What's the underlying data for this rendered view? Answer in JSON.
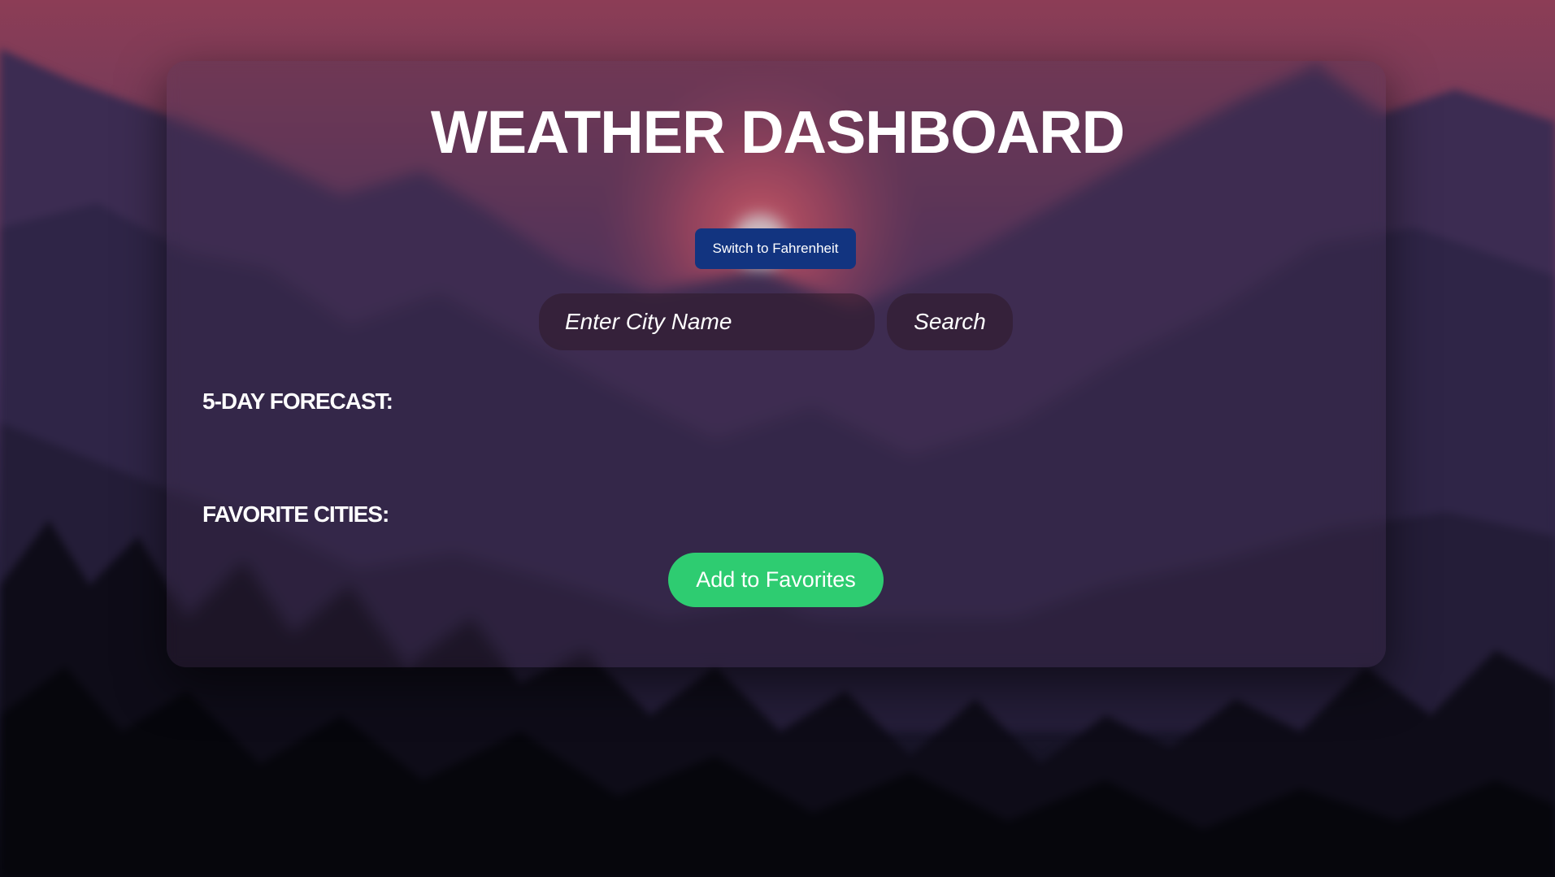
{
  "app": {
    "title": "WEATHER DASHBOARD"
  },
  "controls": {
    "unit_toggle_label": "Switch to Fahrenheit",
    "search_placeholder": "Enter City Name",
    "search_value": "",
    "search_button_label": "Search",
    "add_favorite_label": "Add to Favorites"
  },
  "sections": {
    "forecast_heading": "5-DAY FORECAST:",
    "favorites_heading": "FAVORITE CITIES:"
  },
  "forecast_days": [],
  "favorite_cities": [],
  "colors": {
    "unit_button": "#123480",
    "add_favorite_button": "#2ecc71",
    "text": "#ffffff"
  }
}
